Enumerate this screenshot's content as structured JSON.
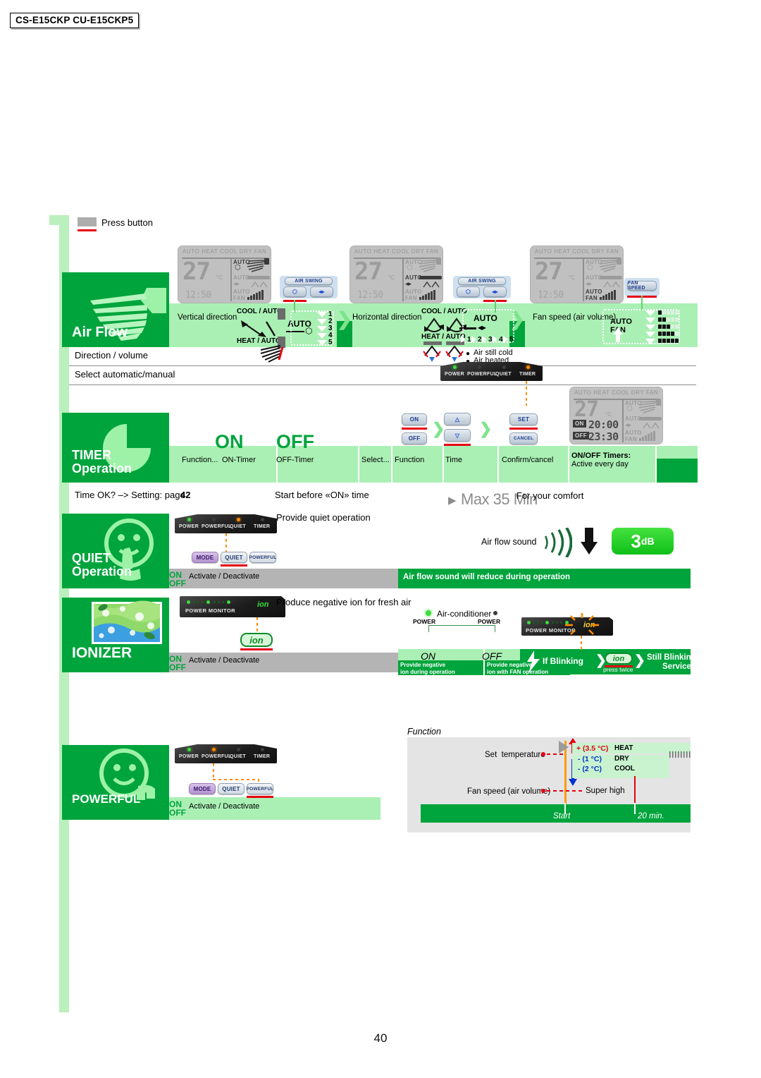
{
  "document": {
    "model_badge": "CS-E15CKP CU-E15CKP5",
    "page_number": "40"
  },
  "legend": {
    "press_button": "Press button"
  },
  "sections": [
    {
      "id": "air-flow",
      "title": "Air Flow",
      "caption_1": "Direction / volume",
      "caption_2": "Select automatic/manual",
      "steps": [
        {
          "label": "Vertical direction",
          "button_group": "AIR SWING",
          "mode_cool": "COOL / AUTO",
          "mode_heat": "HEAT / AUTO",
          "auto_label": "AUTO",
          "positions": [
            "1",
            "2",
            "3",
            "4",
            "5"
          ]
        },
        {
          "label": "Horizontal direction",
          "button_group": "AIR SWING",
          "mode_cool": "COOL / AUTO",
          "mode_heat": "HEAT / AUTO",
          "auto_label": "AUTO",
          "positions": [
            "1",
            "2",
            "3",
            "4",
            "5"
          ],
          "note_1": "Air still cold",
          "note_2": "Air heated"
        },
        {
          "label": "Fan speed (air volume)",
          "button_group": "FAN SPEED",
          "auto_label": "AUTO",
          "fan_label": "FAN"
        }
      ],
      "lcd": {
        "modes": "AUTO  HEAT  COOL  DRY  FAN",
        "temperature": "27",
        "unit": "°C",
        "clock": "12:50",
        "swing_v": "AUTO",
        "swing_h": "AUTO",
        "fan": "AUTO",
        "fan_sub": "FAN"
      }
    },
    {
      "id": "timer-operation",
      "title": "TIMER Operation",
      "on_label": "ON",
      "off_label": "OFF",
      "cells": [
        "Function...",
        "ON-Timer",
        "OFF-Timer",
        "Select...",
        "Function",
        "Time",
        "Confirm/cancel"
      ],
      "timers_note_line1": "ON/OFF Timers:",
      "timers_note_line2": "Active every day",
      "caption_1": "Time OK? –> Setting: page",
      "caption_1_page": "42",
      "caption_2": "Start before «ON» time",
      "buttons": [
        "ON",
        "OFF",
        "SET",
        "CANCEL"
      ],
      "indicator_leds": [
        "POWER",
        "POWERFUL",
        "QUIET",
        "TIMER"
      ],
      "lcd": {
        "modes": "AUTO  HEAT  COOL  DRY  FAN",
        "temperature": "27",
        "unit": "°C",
        "on_tag": "ON",
        "on_time": "20:00",
        "off_tag": "OFF",
        "off_time": "23:30",
        "swing_v": "AUTO",
        "swing_h": "AUTO",
        "fan": "AUTO",
        "fan_sub": "FAN"
      }
    },
    {
      "id": "quiet-operation",
      "title_line1": "QUIET",
      "title_line2": "Operation",
      "desc": "Provide quiet operation",
      "max_time": "Max 35 Min",
      "comfort": "For your comfort",
      "air_flow_sound": "Air flow sound",
      "db_value": "3",
      "db_unit": "dB",
      "green_bar": "Air flow sound will reduce during operation",
      "on_label": "ON",
      "off_label": "OFF",
      "activate": "Activate / Deactivate",
      "indicator_leds": [
        "POWER",
        "POWERFUL",
        "QUIET",
        "TIMER"
      ],
      "buttons": [
        "MODE",
        "QUIET",
        "POWERFUL"
      ]
    },
    {
      "id": "ionizer",
      "title": "IONIZER",
      "desc": "Produce negative ion for fresh air",
      "on_label": "ON",
      "off_label": "OFF",
      "activate": "Activate / Deactivate",
      "power_monitor": "POWER MONITOR",
      "ion_label": "ion",
      "ion_button": "ion",
      "airconditioner": "Air-conditioner",
      "power_left": "POWER",
      "power_right": "POWER",
      "state_on": "ON",
      "state_off": "OFF",
      "state_on_note": "Provide negative\nion during operation",
      "state_off_note": "Provide negative\nion with FAN operation",
      "blink_if": "If Blinking",
      "blink_press": "press twice",
      "blink_still_1": "Still Blinking -  Call",
      "blink_still_2": "Service"
    },
    {
      "id": "powerful",
      "title": "POWERFUL",
      "on_label": "ON",
      "off_label": "OFF",
      "activate": "Activate / Deactivate",
      "indicator_leds": [
        "POWER",
        "POWERFUL",
        "QUIET",
        "TIMER"
      ],
      "buttons": [
        "MODE",
        "QUIET",
        "POWERFUL"
      ],
      "function_title": "Function",
      "chart": {
        "set_temperature": "Set  temperature",
        "fan_speed": "Fan speed (air volume)",
        "super_high": "Super high",
        "heat_delta": "+ (3.5 °C)",
        "heat_mode": "HEAT",
        "dry_delta": "- (1 °C)",
        "dry_mode": "DRY",
        "cool_delta": "- (2 °C)",
        "cool_mode": "COOL",
        "start": "Start",
        "end": "20 min."
      }
    }
  ],
  "chart_data": {
    "type": "line",
    "title": "Function",
    "xlabel": "",
    "ylabel": "",
    "x_annotations": [
      "Start",
      "20 min."
    ],
    "series": [
      {
        "name": "Set temperature",
        "annotation": "Set  temperature"
      },
      {
        "name": "Fan speed (air volume)",
        "annotation": "Super high"
      }
    ],
    "deltas": [
      {
        "label": "+ (3.5 °C)",
        "mode": "HEAT",
        "value": 3.5,
        "color": "#e60012"
      },
      {
        "label": "- (1 °C)",
        "mode": "DRY",
        "value": -1,
        "color": "#0033cc"
      },
      {
        "label": "- (2 °C)",
        "mode": "COOL",
        "value": -2,
        "color": "#0033cc"
      }
    ],
    "duration_minutes": 20
  },
  "colors": {
    "brand_green": "#00a43c",
    "pale_green": "#aaf0b4",
    "rail_green": "#b9f0bd",
    "grey_band": "#b4b4b4",
    "light_grey": "#e4e4e4",
    "red": "#e60012",
    "orange": "#ff8a00",
    "blue": "#0033cc"
  }
}
